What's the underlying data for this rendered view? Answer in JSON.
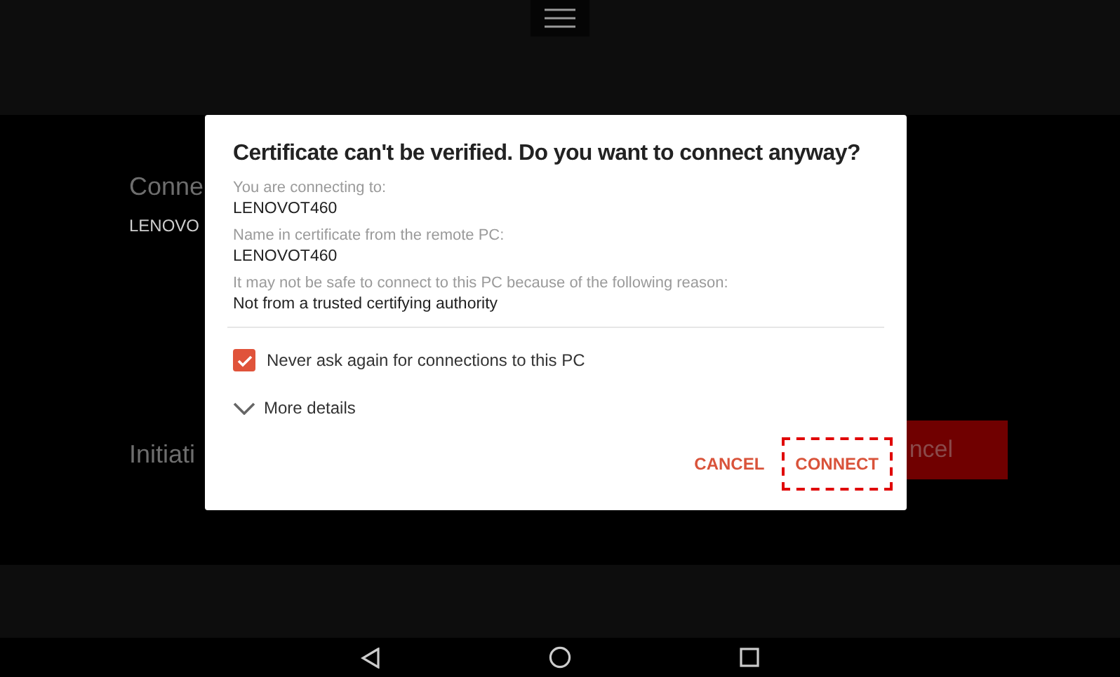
{
  "background": {
    "heading": "Conne",
    "pc_name": "LENOVO",
    "status": "Initiati",
    "button": "ncel"
  },
  "dialog": {
    "title": "Certificate can't be verified. Do you want to connect anyway?",
    "fields": [
      {
        "label": "You are connecting to:",
        "value": "LENOVOT460"
      },
      {
        "label": "Name in certificate from the remote PC:",
        "value": "LENOVOT460"
      },
      {
        "label": "It may not be safe to connect to this PC because of the following reason:",
        "value": "Not from a trusted certifying authority"
      }
    ],
    "checkbox": {
      "label": "Never ask again for connections to this PC",
      "checked": true
    },
    "details": {
      "label": "More details",
      "expanded": false
    },
    "buttons": [
      {
        "label": "CANCEL",
        "highlighted": false
      },
      {
        "label": "CONNECT",
        "highlighted": true
      }
    ]
  }
}
